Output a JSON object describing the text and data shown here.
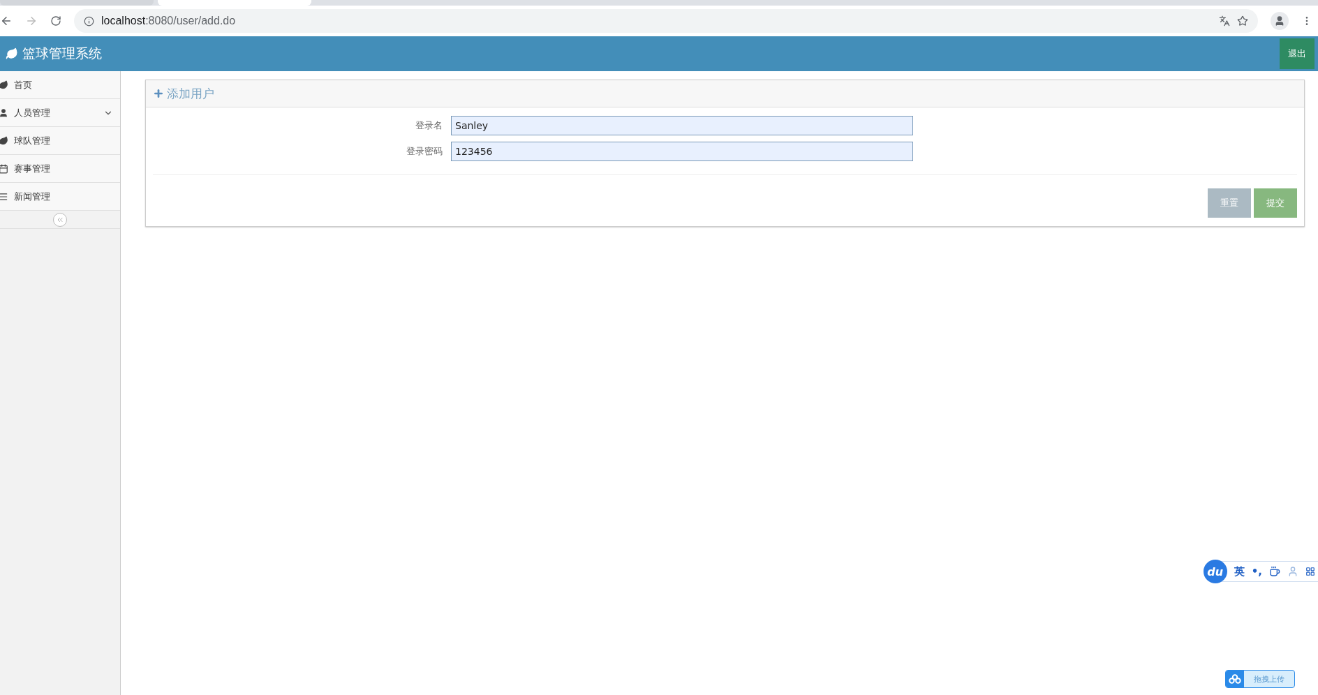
{
  "browser": {
    "tabs": [
      {
        "selected": false
      },
      {
        "selected": true
      }
    ],
    "url_host": "localhost",
    "url_path": ":8080/user/add.do"
  },
  "header": {
    "title": "篮球管理系统",
    "logout": "退出"
  },
  "sidebar": {
    "items": [
      {
        "label": "首页",
        "expandable": false
      },
      {
        "label": "人员管理",
        "expandable": true
      },
      {
        "label": "球队管理",
        "expandable": false
      },
      {
        "label": "赛事管理",
        "expandable": false
      },
      {
        "label": "新闻管理",
        "expandable": false
      }
    ]
  },
  "panel": {
    "title": "添加用户",
    "fields": [
      {
        "label": "登录名",
        "value": "Sanley"
      },
      {
        "label": "登录密码",
        "value": "123456"
      }
    ],
    "buttons": [
      {
        "label": "重置",
        "kind": "reset"
      },
      {
        "label": "提交",
        "kind": "submit"
      }
    ]
  },
  "ime_toolbar": {
    "logo": "du",
    "language": "英",
    "punctuation": "•,"
  },
  "upload_widget": {
    "label": "拖拽上传"
  }
}
